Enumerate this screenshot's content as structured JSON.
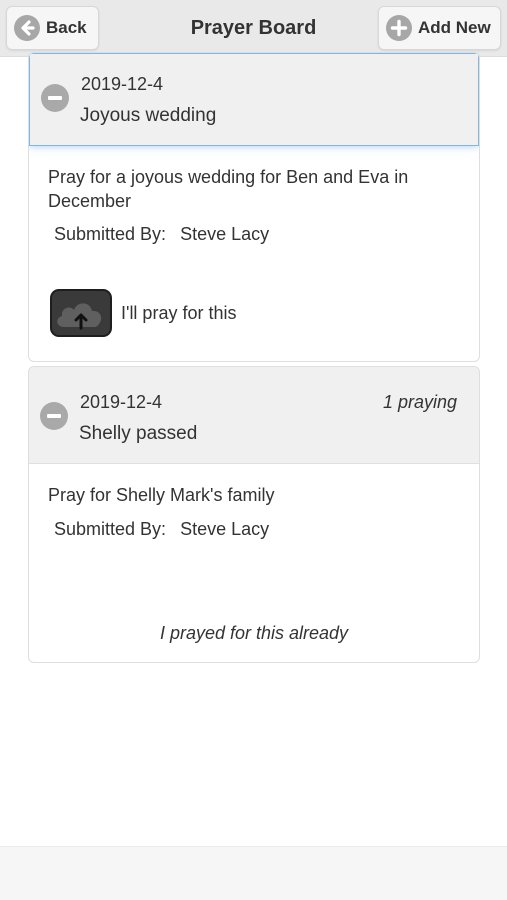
{
  "header": {
    "title": "Prayer Board",
    "back_label": "Back",
    "add_label": "Add New"
  },
  "prayers": [
    {
      "date": "2019-12-4",
      "subject": "Joyous wedding",
      "body": "Pray for a joyous wedding for Ben and Eva in December",
      "submitted_label": "Submitted By:",
      "submitted_by": "Steve Lacy",
      "action_label": "I'll pray for this"
    },
    {
      "date": "2019-12-4",
      "subject": "Shelly passed",
      "praying_count": "1 praying",
      "body": "Pray for Shelly Mark's family",
      "submitted_label": "Submitted By:",
      "submitted_by": "Steve Lacy",
      "status_text": "I prayed for this already"
    }
  ],
  "icons": {
    "back": "arrow-left-circle-icon",
    "add": "plus-circle-icon",
    "collapse": "minus-circle-icon",
    "pray": "cloud-upload-icon"
  },
  "colors": {
    "header_bg": "#e9e9e9",
    "card_head_bg": "#f0f0f0",
    "focus_glow": "#7fb6e3",
    "icon_gray": "#a9a9a9"
  }
}
